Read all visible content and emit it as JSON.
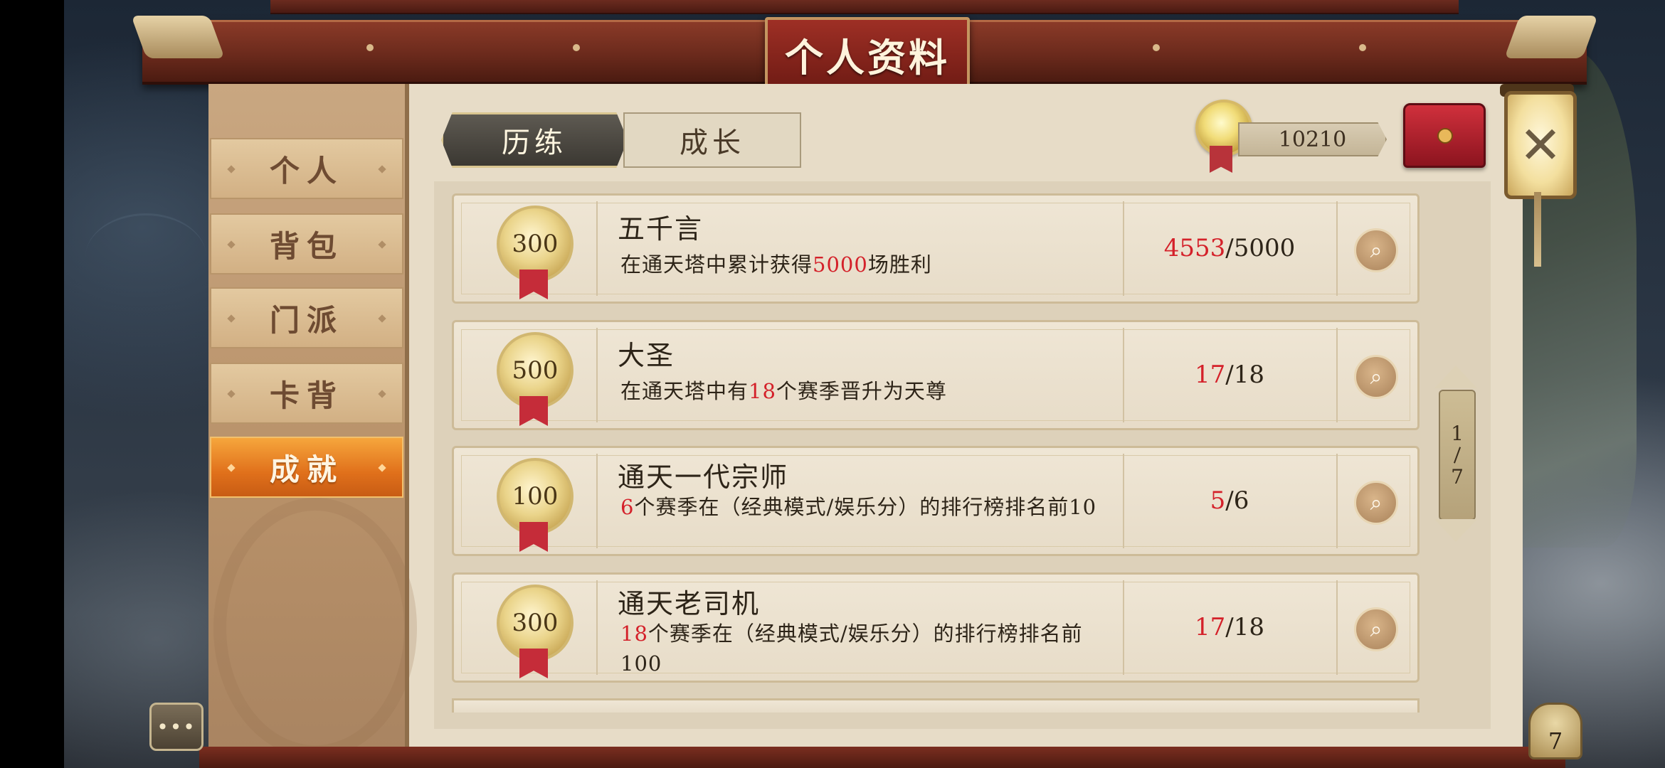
{
  "title": "个人资料",
  "sidebar": {
    "items": [
      {
        "label": "个人"
      },
      {
        "label": "背包"
      },
      {
        "label": "门派"
      },
      {
        "label": "卡背"
      },
      {
        "label": "成就"
      }
    ]
  },
  "tabs": [
    {
      "label": "历练"
    },
    {
      "label": "成长"
    }
  ],
  "currency": {
    "value": "10210",
    "icon": "coin-icon"
  },
  "achievements": [
    {
      "points": "300",
      "name": "五千言",
      "desc_pre": "在通天塔中累计获得",
      "desc_hl": "5000",
      "desc_post": "场胜利",
      "current": "4553",
      "total": "/5000"
    },
    {
      "points": "500",
      "name": "大圣",
      "desc_pre": "在通天塔中有",
      "desc_hl": "18",
      "desc_post": "个赛季晋升为天尊",
      "current": "17",
      "total": "/18"
    },
    {
      "points": "100",
      "name": "通天一代宗师",
      "desc_pre": "",
      "desc_hl": "6",
      "desc_post": "个赛季在（经典模式/娱乐分）的排行榜排名前10",
      "current": "5",
      "total": "/6"
    },
    {
      "points": "300",
      "name": "通天老司机",
      "desc_pre": "",
      "desc_hl": "18",
      "desc_post": "个赛季在（经典模式/娱乐分）的排行榜排名前100",
      "current": "17",
      "total": "/18"
    }
  ],
  "pager": {
    "current": "1",
    "total": "7"
  },
  "chat_label": "•••",
  "corner_badge": "7",
  "colors": {
    "highlight": "#d4212a",
    "active_nav": "#e0701b",
    "title_plaque": "#9e2f25"
  }
}
